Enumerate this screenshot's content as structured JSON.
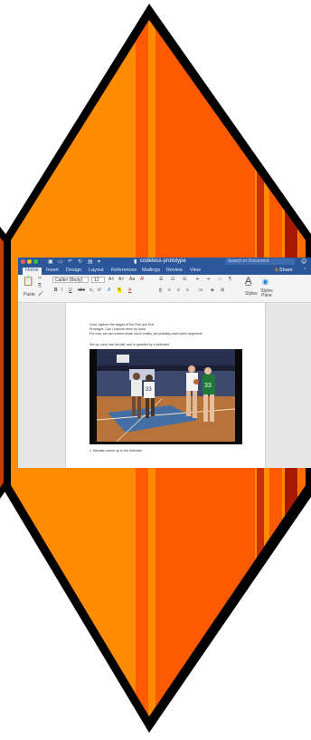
{
  "window": {
    "document_title": "codeless-prototype",
    "search_placeholder": "Search in Document",
    "face_icon": "smiley-feedback-icon"
  },
  "tabs": [
    "Home",
    "Insert",
    "Design",
    "Layout",
    "References",
    "Mailings",
    "Review",
    "View"
  ],
  "share_label": "Share",
  "ribbon": {
    "paste_label": "Paste",
    "font_name": "Calibri (Body)",
    "font_size": "12",
    "styles_label": "Styles",
    "styles_pane_label": "Styles Pane"
  },
  "document": {
    "lines": [
      "Goal: capture the stages of the Pick and Roll",
      "Prototype: Can I capture them by hand",
      "For now, we use screen shots, but in reality, we probably want video segments",
      "Set up-Larry has the ball, and is guarded by a defender"
    ],
    "caption": "1. Michale comes up to the defender",
    "jersey_number": "33"
  },
  "colors": {
    "title_blue": "#2b579a",
    "orange_main": "#ff8c00",
    "orange_red": "#ff5a00",
    "dark_red": "#a81a00",
    "court_floor": "#b8733a"
  }
}
